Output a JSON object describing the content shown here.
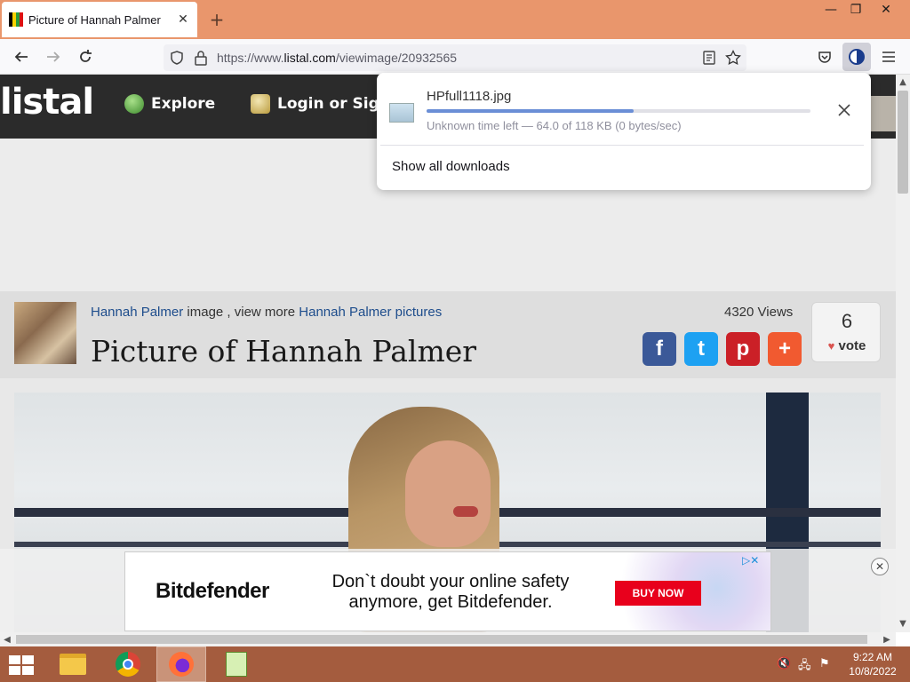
{
  "browser": {
    "tab_title": "Picture of Hannah Palmer",
    "url_prefix": "https://www.",
    "url_host": "listal.com",
    "url_path": "/viewimage/20932565",
    "window_controls": {
      "minimize": "—",
      "restore": "❐",
      "close": "✕"
    },
    "new_tab": "+",
    "tab_close": "✕"
  },
  "site": {
    "logo": "listal",
    "nav": [
      {
        "label": "Explore",
        "icon": "globe-icon"
      },
      {
        "label": "Login or Sign",
        "icon": "key-icon"
      }
    ]
  },
  "info": {
    "breadcrumb_link1": "Hannah Palmer",
    "breadcrumb_mid": " image , view more ",
    "breadcrumb_link2": "Hannah Palmer pictures",
    "title": "Picture of Hannah Palmer",
    "views": "4320 Views",
    "vote_count": "6",
    "vote_label": "vote",
    "share_buttons": [
      {
        "name": "facebook",
        "glyph": "f",
        "color": "#3b5998"
      },
      {
        "name": "twitter",
        "glyph": "t",
        "color": "#1da1f2"
      },
      {
        "name": "pinterest",
        "glyph": "p",
        "color": "#cb2027"
      },
      {
        "name": "more",
        "glyph": "+",
        "color": "#f15a30"
      }
    ]
  },
  "download": {
    "filename": "HPfull1118.jpg",
    "status": "Unknown time left — 64.0 of 118 KB (0 bytes/sec)",
    "progress": 0.54,
    "show_all": "Show all downloads"
  },
  "ad": {
    "brand": "Bitdefender",
    "text": "Don`t doubt your online safety anymore, get Bitdefender.",
    "cta": "BUY NOW"
  },
  "taskbar": {
    "time": "9:22 AM",
    "date": "10/8/2022"
  },
  "colors": {
    "accent_titlebar": "#e9966c",
    "taskbar": "#a45c3e",
    "link": "#1e4d8c",
    "progress": "#6a8ed6"
  }
}
